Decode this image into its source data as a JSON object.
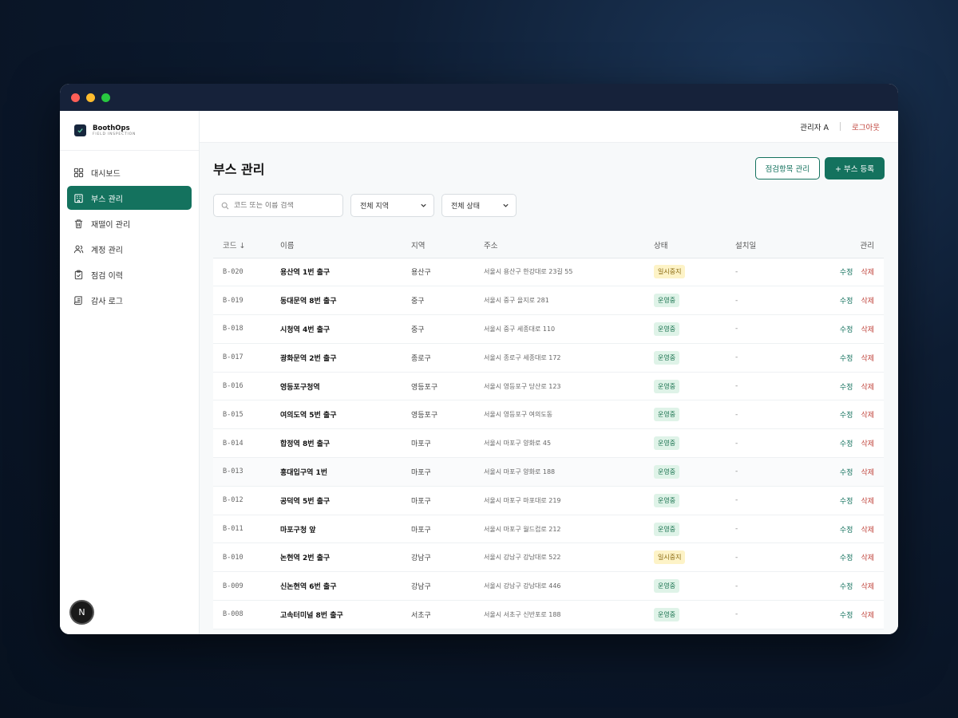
{
  "brand": {
    "name": "BoothOps",
    "sub": "FIELD INSPECTION"
  },
  "nav": [
    {
      "label": "대시보드",
      "icon": "grid-icon"
    },
    {
      "label": "부스 관리",
      "icon": "building-icon",
      "active": true
    },
    {
      "label": "재떨이 관리",
      "icon": "trash-icon"
    },
    {
      "label": "계정 관리",
      "icon": "users-icon"
    },
    {
      "label": "점검 이력",
      "icon": "clipboard-check-icon"
    },
    {
      "label": "감사 로그",
      "icon": "scroll-icon"
    }
  ],
  "topbar": {
    "admin": "관리자 A",
    "logout": "로그아웃"
  },
  "page": {
    "title": "부스 관리",
    "btn_items": "점검항목 관리",
    "btn_add": "+ 부스 등록"
  },
  "filters": {
    "search_placeholder": "코드 또는 이름 검색",
    "region": "전체 지역",
    "status": "전체 상태"
  },
  "table": {
    "headers": {
      "code": "코드 ↓",
      "name": "이름",
      "region": "지역",
      "address": "주소",
      "status": "상태",
      "date": "설치일",
      "actions": "관리"
    },
    "edit_label": "수정",
    "delete_label": "삭제",
    "rows": [
      {
        "code": "B-020",
        "name": "용산역 1번 출구",
        "region": "용산구",
        "address": "서울시 용산구 한강대로 23길 55",
        "status": "일시중지",
        "date": "-"
      },
      {
        "code": "B-019",
        "name": "동대문역 8번 출구",
        "region": "중구",
        "address": "서울시 중구 을지로 281",
        "status": "운영중",
        "date": "-"
      },
      {
        "code": "B-018",
        "name": "시청역 4번 출구",
        "region": "중구",
        "address": "서울시 중구 세종대로 110",
        "status": "운영중",
        "date": "-"
      },
      {
        "code": "B-017",
        "name": "광화문역 2번 출구",
        "region": "종로구",
        "address": "서울시 종로구 세종대로 172",
        "status": "운영중",
        "date": "-"
      },
      {
        "code": "B-016",
        "name": "영등포구청역",
        "region": "영등포구",
        "address": "서울시 영등포구 당산로 123",
        "status": "운영중",
        "date": "-"
      },
      {
        "code": "B-015",
        "name": "여의도역 5번 출구",
        "region": "영등포구",
        "address": "서울시 영등포구 여의도동",
        "status": "운영중",
        "date": "-"
      },
      {
        "code": "B-014",
        "name": "합정역 8번 출구",
        "region": "마포구",
        "address": "서울시 마포구 양화로 45",
        "status": "운영중",
        "date": "-"
      },
      {
        "code": "B-013",
        "name": "홍대입구역 1번",
        "region": "마포구",
        "address": "서울시 마포구 양화로 188",
        "status": "운영중",
        "date": "-"
      },
      {
        "code": "B-012",
        "name": "공덕역 5번 출구",
        "region": "마포구",
        "address": "서울시 마포구 마포대로 219",
        "status": "운영중",
        "date": "-"
      },
      {
        "code": "B-011",
        "name": "마포구청 앞",
        "region": "마포구",
        "address": "서울시 마포구 월드컵로 212",
        "status": "운영중",
        "date": "-"
      },
      {
        "code": "B-010",
        "name": "논현역 2번 출구",
        "region": "강남구",
        "address": "서울시 강남구 강남대로 522",
        "status": "일시중지",
        "date": "-"
      },
      {
        "code": "B-009",
        "name": "신논현역 6번 출구",
        "region": "강남구",
        "address": "서울시 강남구 강남대로 446",
        "status": "운영중",
        "date": "-"
      },
      {
        "code": "B-008",
        "name": "고속터미널 8번 출구",
        "region": "서초구",
        "address": "서울시 서초구 신반포로 188",
        "status": "운영중",
        "date": "-"
      }
    ]
  }
}
